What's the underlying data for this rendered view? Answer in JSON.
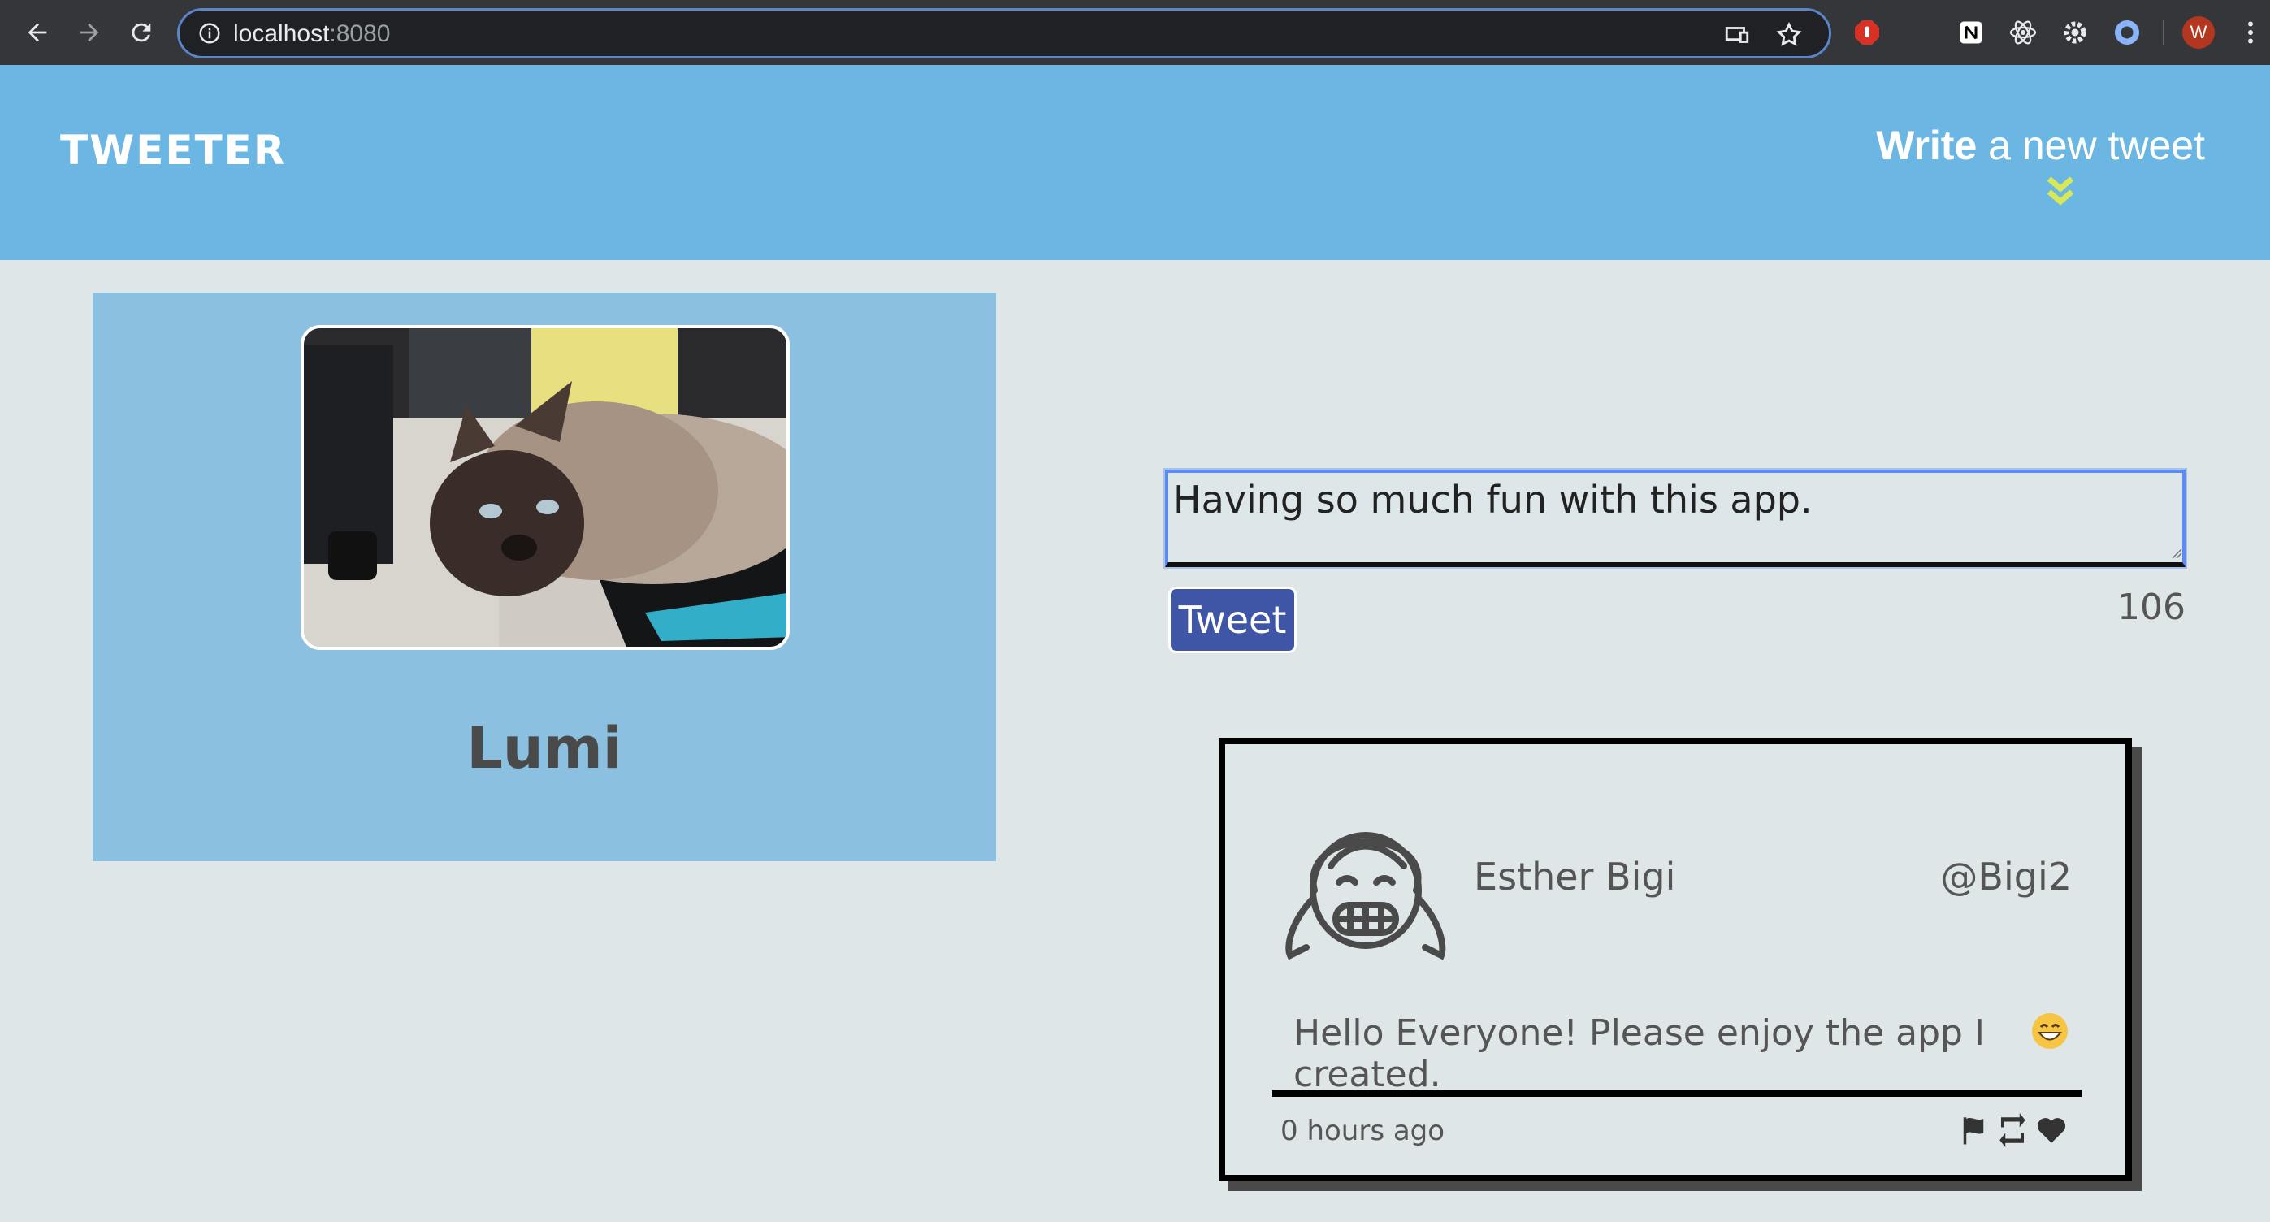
{
  "browser": {
    "url_host": "localhost",
    "url_port": ":8080",
    "profile_initial": "W"
  },
  "header": {
    "logo": "TWEETER",
    "compose_toggle_bold": "Write",
    "compose_toggle_rest": " a new tweet"
  },
  "profile": {
    "name": "Lumi"
  },
  "compose": {
    "input_value": "Having so much fun with this app.",
    "button_label": "Tweet",
    "char_counter": "106"
  },
  "tweet": {
    "author": "Esther Bigi",
    "handle": "@Bigi2",
    "content": "Hello Everyone! Please enjoy the app I created.",
    "timestamp": "0 hours ago",
    "actions": [
      "flag-icon",
      "retweet-icon",
      "heart-icon"
    ]
  },
  "colors": {
    "header_bg": "#6bb6e2",
    "card_bg": "#8cc0e0",
    "button_bg": "#3f55a5",
    "chevron": "#d8e85a"
  }
}
